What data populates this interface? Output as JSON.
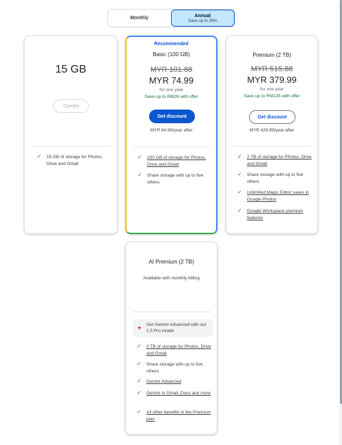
{
  "billing_toggle": {
    "monthly_label": "Monthly",
    "annual_label": "Annual",
    "annual_sub": "Save up to 26%"
  },
  "plans": [
    {
      "name": "15 GB",
      "button": "Current",
      "features": [
        "15 GB of storage for Photos, Drive and Gmail"
      ]
    },
    {
      "badge": "Recommended",
      "name": "Basic (100 GB)",
      "old_price": "MYR 101.88",
      "price": "MYR 74.99",
      "period": "for one year",
      "save": "Save up to RM26 with offer",
      "button": "Get discount",
      "after": "MYR 84.99/year after",
      "features": [
        "100 GB of storage for Photos, Drive and Gmail",
        "Share storage with up to five others"
      ]
    },
    {
      "name": "Premium (2 TB)",
      "old_price": "MYR 515.88",
      "price": "MYR 379.99",
      "period": "for one year",
      "save": "Save up to RM135 with offer",
      "button": "Get discount",
      "after": "MYR 429.99/year after",
      "features": [
        "2 TB of storage for Photos, Drive and Gmail",
        "Share storage with up to five others",
        "Unlimited Magic Editor saves in Google Photos",
        "Google Workspace premium features"
      ]
    },
    {
      "name": "AI Premium (2 TB)",
      "note": "Available with monthly billing",
      "highlight": "Get Gemini Advanced with our 1.5 Pro model",
      "features": [
        "2 TB of storage for Photos, Drive and Gmail",
        "Share storage with up to five others",
        "Gemini Advanced",
        "Gemini in Gmail, Docs and more",
        "All other benefits in the Premium plan"
      ]
    }
  ],
  "icons": {
    "check": "check-icon",
    "spark": "gemini-spark-icon"
  },
  "colors": {
    "primary_blue": "#0b57d0",
    "toggle_active": "#c2e7ff",
    "save_green": "#137333",
    "check_green": "#188038",
    "spark_red": "#d93025"
  }
}
